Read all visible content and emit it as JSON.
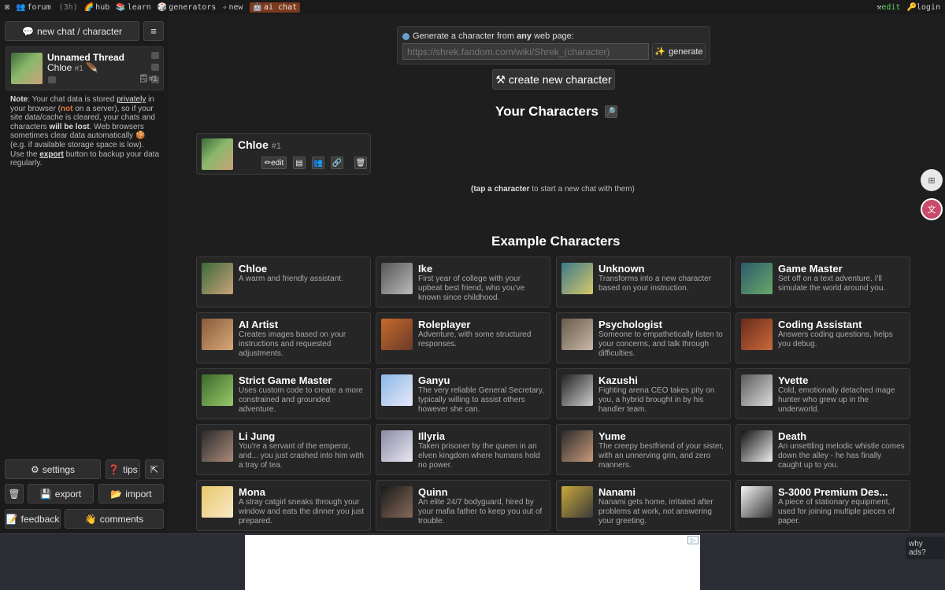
{
  "topbar": {
    "items": [
      "forum",
      "(3h)",
      "hub",
      "learn",
      "generators",
      "new",
      "ai chat"
    ],
    "right": [
      "edit",
      "login"
    ]
  },
  "sidebar": {
    "new_chat_label": "new chat / character",
    "menu_icon": "≡",
    "thread": {
      "title": "Unnamed Thread",
      "character": "Chloe",
      "character_num": "#1",
      "count": "#1"
    },
    "note": {
      "p1": "Note",
      "p2": ": Your chat data is stored ",
      "p3": "privately",
      "p4": " in your browser (",
      "p5": "not",
      "p6": " on a server), so if your site data/cache is cleared, your chats and characters ",
      "p7": "will be lost",
      "p8": ". Web browsers sometimes clear data automatically",
      "p9": " (e.g. if available storage space is low). Use the ",
      "p10": "export",
      "p11": " button to backup your data regularly."
    },
    "settings_label": "settings",
    "tips_label": "tips",
    "export_label": "export",
    "import_label": "import",
    "feedback_label": "feedback",
    "comments_label": "comments"
  },
  "generator": {
    "label_a": "Generate a character from ",
    "label_b": "any",
    "label_c": " web page:",
    "url_placeholder": "https://shrek.fandom.com/wiki/Shrek_(character)",
    "generate_label": "generate",
    "create_label": "create new character"
  },
  "your_characters": {
    "heading": "Your Characters",
    "char_name": "Chloe",
    "char_num": "#1",
    "edit_label": "edit",
    "hint_a": "(tap a character",
    "hint_b": " to start a new chat with them)"
  },
  "examples": {
    "heading": "Example Characters",
    "cards": [
      {
        "name": "Chloe",
        "desc": "A warm and friendly assistant."
      },
      {
        "name": "Ike",
        "desc": "First year of college with your upbeat best friend, who you've known since childhood."
      },
      {
        "name": "Unknown",
        "desc": "Transforms into a new character based on your instruction."
      },
      {
        "name": "Game Master",
        "desc": "Set off on a text adventure. I'll simulate the world around you."
      },
      {
        "name": "AI Artist",
        "desc": "Creates images based on your instructions and requested adjustments."
      },
      {
        "name": "Roleplayer",
        "desc": "Adventure, with some structured responses."
      },
      {
        "name": "Psychologist",
        "desc": "Someone to empathetically listen to your concerns, and talk through difficulties."
      },
      {
        "name": "Coding Assistant",
        "desc": "Answers coding questions, helps you debug."
      },
      {
        "name": "Strict Game Master",
        "desc": "Uses custom code to create a more constrained and grounded adventure."
      },
      {
        "name": "Ganyu",
        "desc": "The very reliable General Secretary, typically willing to assist others however she can."
      },
      {
        "name": "Kazushi",
        "desc": "Fighting arena CEO takes pity on you, a hybrid brought in by his handler team."
      },
      {
        "name": "Yvette",
        "desc": "Cold, emotionally detached mage hunter who grew up in the underworld."
      },
      {
        "name": "Li Jung",
        "desc": "You're a servant of the emperor, and... you just crashed into him with a tray of tea."
      },
      {
        "name": "Illyria",
        "desc": "Taken prisoner by the queen in an elven kingdom where humans hold no power."
      },
      {
        "name": "Yume",
        "desc": "The creepy bestfriend of your sister, with an unnerving grin, and zero manners."
      },
      {
        "name": "Death",
        "desc": "An unsettling melodic whistle comes down the alley - he has finally caught up to you."
      },
      {
        "name": "Mona",
        "desc": "A stray catgirl sneaks through your window and eats the dinner you just prepared."
      },
      {
        "name": "Quinn",
        "desc": "An elite 24/7 bodyguard, hired by your mafia father to keep you out of trouble."
      },
      {
        "name": "Nanami",
        "desc": "Nanami gets home, irritated after problems at work, not answering your greeting."
      },
      {
        "name": "S-3000 Premium Des...",
        "desc": "A piece of stationary equipment, used for joining multiple pieces of paper."
      }
    ],
    "avatar_colors": [
      [
        "#3c6a3a",
        "#c9a27a"
      ],
      [
        "#555555",
        "#bbbbbb"
      ],
      [
        "#3a7a8a",
        "#d8c86a"
      ],
      [
        "#2a5a6a",
        "#6aa86a"
      ],
      [
        "#8a5a3a",
        "#d8a878"
      ],
      [
        "#c86a2a",
        "#6a3a2a"
      ],
      [
        "#6a5a4a",
        "#c8b8a8"
      ],
      [
        "#6a2a1a",
        "#c86a3a"
      ],
      [
        "#3a6a2a",
        "#9ac86a"
      ],
      [
        "#8ab8e8",
        "#e8e8f8"
      ],
      [
        "#222222",
        "#cccccc"
      ],
      [
        "#5a5a5a",
        "#dddddd"
      ],
      [
        "#2a2a2a",
        "#aa8a7a"
      ],
      [
        "#8a8aa8",
        "#e8e8f0"
      ],
      [
        "#2a2a2a",
        "#c89a7a"
      ],
      [
        "#111111",
        "#eeeeee"
      ],
      [
        "#e8c86a",
        "#f8e8c8"
      ],
      [
        "#1a1a1a",
        "#886a5a"
      ],
      [
        "#c8a83a",
        "#3a3a3a"
      ],
      [
        "#f4f4f4",
        "#333333"
      ]
    ]
  },
  "ad": {
    "why_ads": "why ads?"
  }
}
